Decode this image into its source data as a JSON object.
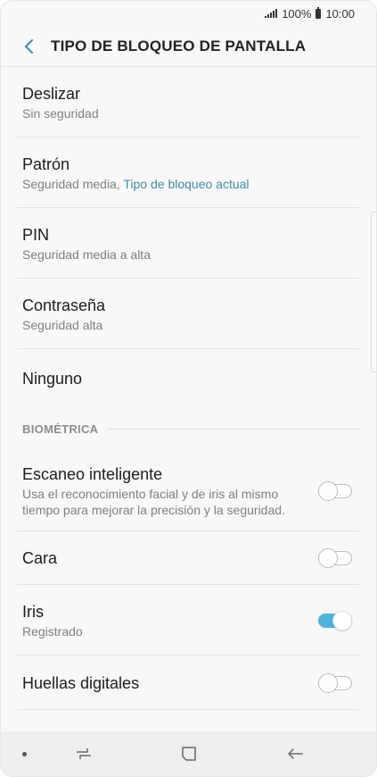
{
  "status_bar": {
    "battery": "100%",
    "time": "10:00"
  },
  "header": {
    "title": "TIPO DE BLOQUEO DE PANTALLA"
  },
  "lock_types": [
    {
      "title": "Deslizar",
      "subtitle": "Sin seguridad",
      "subtitle_accent": ""
    },
    {
      "title": "Patrón",
      "subtitle": "Seguridad media, ",
      "subtitle_accent": "Tipo de bloqueo actual"
    },
    {
      "title": "PIN",
      "subtitle": "Seguridad media a alta",
      "subtitle_accent": ""
    },
    {
      "title": "Contraseña",
      "subtitle": "Seguridad alta",
      "subtitle_accent": ""
    },
    {
      "title": "Ninguno",
      "subtitle": "",
      "subtitle_accent": ""
    }
  ],
  "biometrics": {
    "section_label": "BIOMÉTRICA",
    "items": [
      {
        "title": "Escaneo inteligente",
        "subtitle": "Usa el reconocimiento facial y de iris al mismo tiempo para mejorar la precisión y la seguridad.",
        "enabled": false
      },
      {
        "title": "Cara",
        "subtitle": "",
        "enabled": false
      },
      {
        "title": "Iris",
        "subtitle": "Registrado",
        "enabled": true
      },
      {
        "title": "Huellas digitales",
        "subtitle": "",
        "enabled": false
      }
    ]
  },
  "nav_bar": {
    "icons": [
      "recent-apps-icon",
      "home-icon",
      "back-icon"
    ]
  },
  "colors": {
    "accent": "#3d8ea8",
    "toggle_on": "#4ab3e0"
  }
}
